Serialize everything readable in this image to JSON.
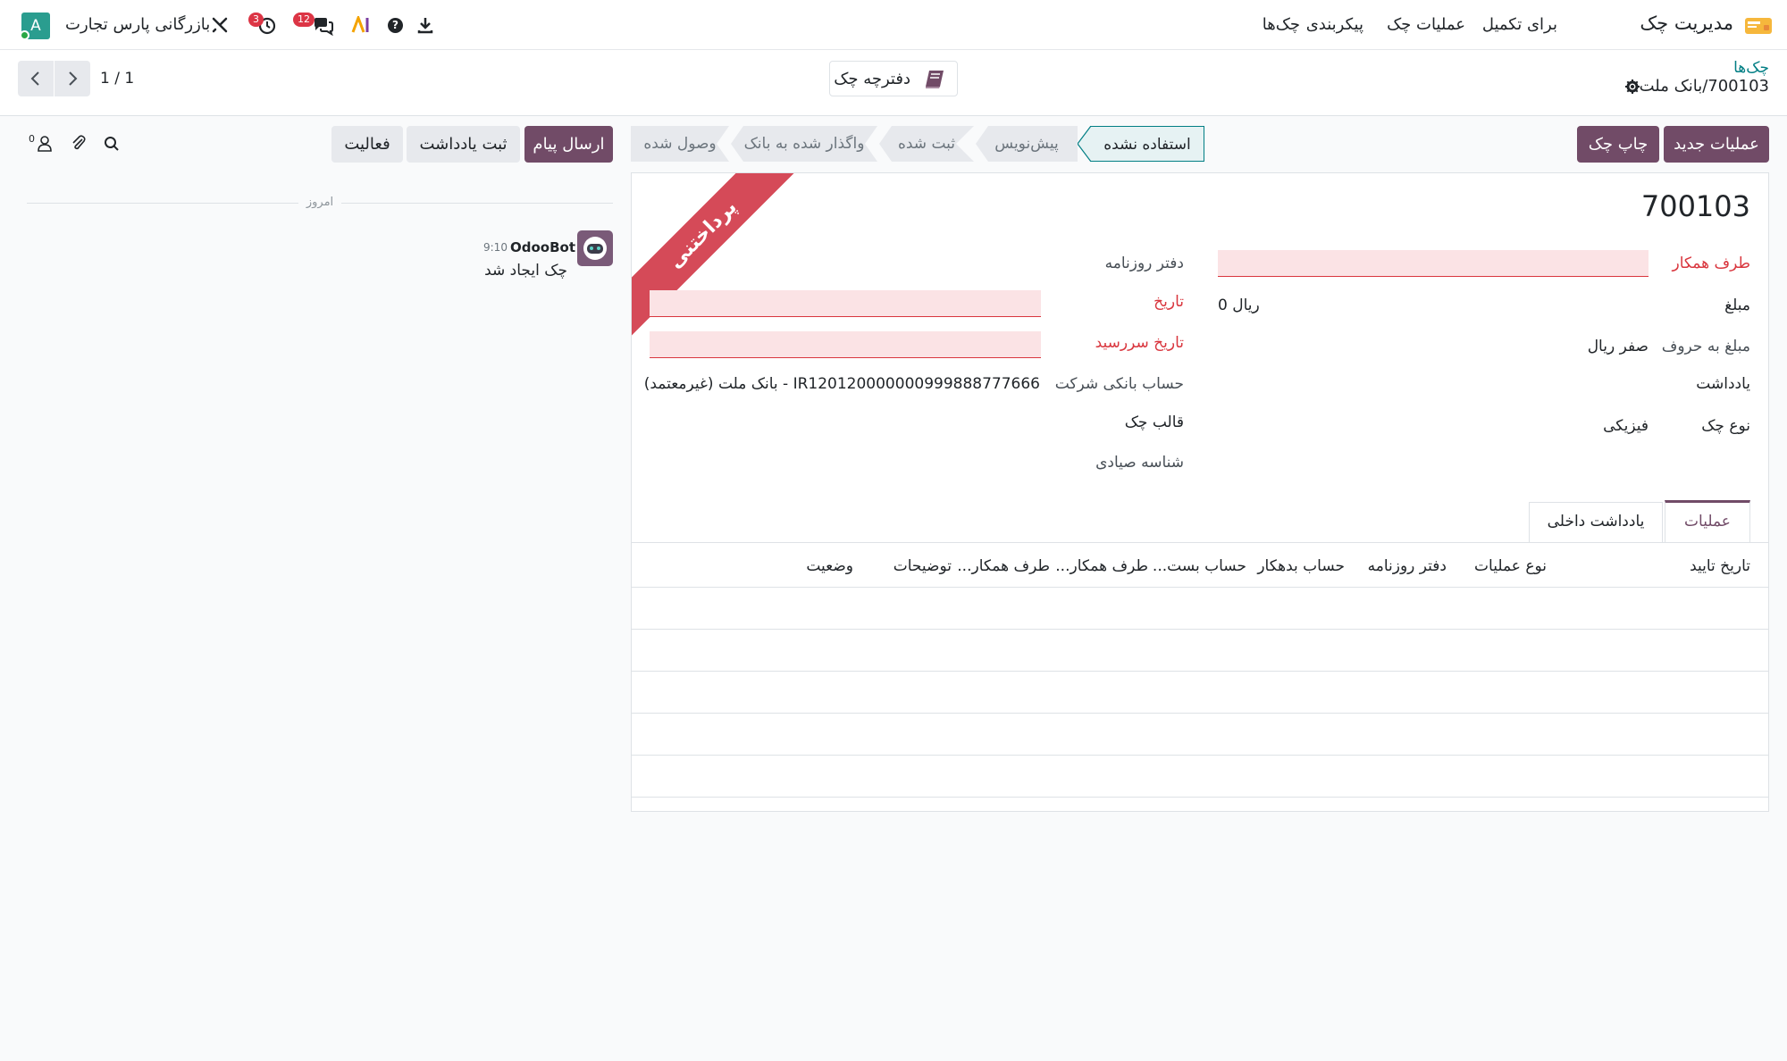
{
  "navbar": {
    "app_title": "مدیریت چک",
    "menu": [
      "چک‌ها",
      "برای تکمیل",
      "عملیات چک",
      "پیکربندی"
    ],
    "company": "بازرگانی پارس تجارت",
    "messages_count": "12",
    "activities_count": "3",
    "avatar_letter": "A"
  },
  "breadcrumb": {
    "parent": "چک‌ها",
    "current": "700103/بانک ملت"
  },
  "control": {
    "checkbook_button": "دفترچه چک",
    "pager": "1 / 1"
  },
  "actions": {
    "new_operation": "عملیات جدید",
    "print_check": "چاپ چک"
  },
  "stages": [
    "استفاده نشده",
    "پیش‌نویس",
    "ثبت شده",
    "واگذار شده به بانک",
    "وصول شده"
  ],
  "active_stage": "استفاده نشده",
  "chatter": {
    "send_message": "ارسال پیام",
    "log_note": "ثبت یادداشت",
    "activity": "فعالیت",
    "followers_count": "0",
    "today": "امروز",
    "author": "OdooBot",
    "time": "9:10",
    "body": "چک ایجاد شد"
  },
  "form": {
    "ribbon": "پرداختنی",
    "check_number": "700103",
    "partner_label": "طرف همکار",
    "amount_label": "مبلغ",
    "amount_value": "ریال 0",
    "amount_words_label": "مبلغ به حروف",
    "amount_words_value": "صفر ریال",
    "memo_label": "یادداشت",
    "check_type_label": "نوع چک",
    "check_type_value": "فیزیکی",
    "journal_label": "دفتر روزنامه",
    "date_label": "تاریخ",
    "due_date_label": "تاریخ سررسید",
    "bank_account_label": "حساب بانکی شرکت",
    "bank_account_value": "IR120120000000999888777666 - بانک ملت (غیرمعتمد)",
    "template_label": "قالب چک",
    "sayad_label": "شناسه صیادی"
  },
  "tabs": [
    "عملیات",
    "یادداشت داخلی"
  ],
  "table": {
    "columns": [
      "تاریخ تایید",
      "نوع عملیات",
      "دفتر روزنامه",
      "حساب بدهکار",
      "حساب بست...",
      "طرف همکار...",
      "طرف همکار...",
      "توضیحات",
      "وضعیت"
    ]
  },
  "colors": {
    "primary": "#714b67",
    "ribbon": "#d54a58",
    "required": "#d9363e",
    "active_stage_bg": "#e6f2f3",
    "active_stage_border": "#017e84"
  }
}
